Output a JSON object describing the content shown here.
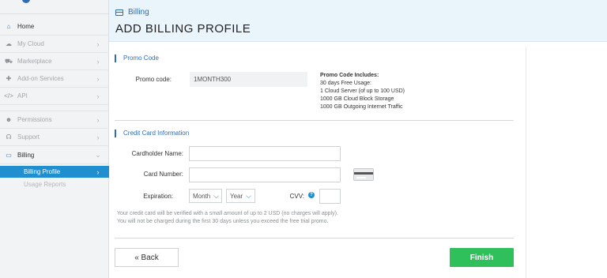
{
  "sidebar": {
    "items": [
      {
        "label": "Home",
        "icon": "home-icon",
        "glyph": "⌂"
      },
      {
        "label": "My Cloud",
        "icon": "cloud-icon",
        "glyph": "☁"
      },
      {
        "label": "Marketplace",
        "icon": "cart-icon",
        "glyph": "🛒"
      },
      {
        "label": "Add-on Services",
        "icon": "puzzle-icon",
        "glyph": "✚"
      },
      {
        "label": "API",
        "icon": "code-icon",
        "glyph": "</>"
      },
      {
        "label": "Permissions",
        "icon": "users-icon",
        "glyph": "👥"
      },
      {
        "label": "Support",
        "icon": "headset-icon",
        "glyph": "☊"
      },
      {
        "label": "Billing",
        "icon": "credit-card-icon",
        "glyph": "▭"
      }
    ],
    "sub_items": [
      {
        "label": "Billing Profile"
      },
      {
        "label": "Usage Reports"
      }
    ]
  },
  "header": {
    "breadcrumb": "Billing",
    "title": "ADD BILLING PROFILE"
  },
  "promo": {
    "section_title": "Promo Code",
    "label": "Promo code:",
    "value": "1MONTH300",
    "includes_title": "Promo Code Includes:",
    "includes": [
      "30 days Free Usage:",
      "1 Cloud Server (of up to 100 USD)",
      "1000 GB Cloud Block Storage",
      "1000 GB Outgoing Internet Traffic"
    ]
  },
  "card": {
    "section_title": "Credit Card Information",
    "holder_label": "Cardholder Name:",
    "number_label": "Card Number:",
    "expiration_label": "Expiration:",
    "month_placeholder": "Month",
    "year_placeholder": "Year",
    "cvv_label": "CVV:",
    "note_line1": "Your credit card will be verified with a small amount of up to 2 USD (no charges will apply).",
    "note_line2": "You will not be charged during the first 30 days unless you exceed the free trial promo."
  },
  "actions": {
    "back_label": "« Back",
    "finish_label": "Finish"
  },
  "colors": {
    "accent": "#2f6db3",
    "active_nav": "#1f8fd0",
    "finish": "#2fbf5b"
  }
}
